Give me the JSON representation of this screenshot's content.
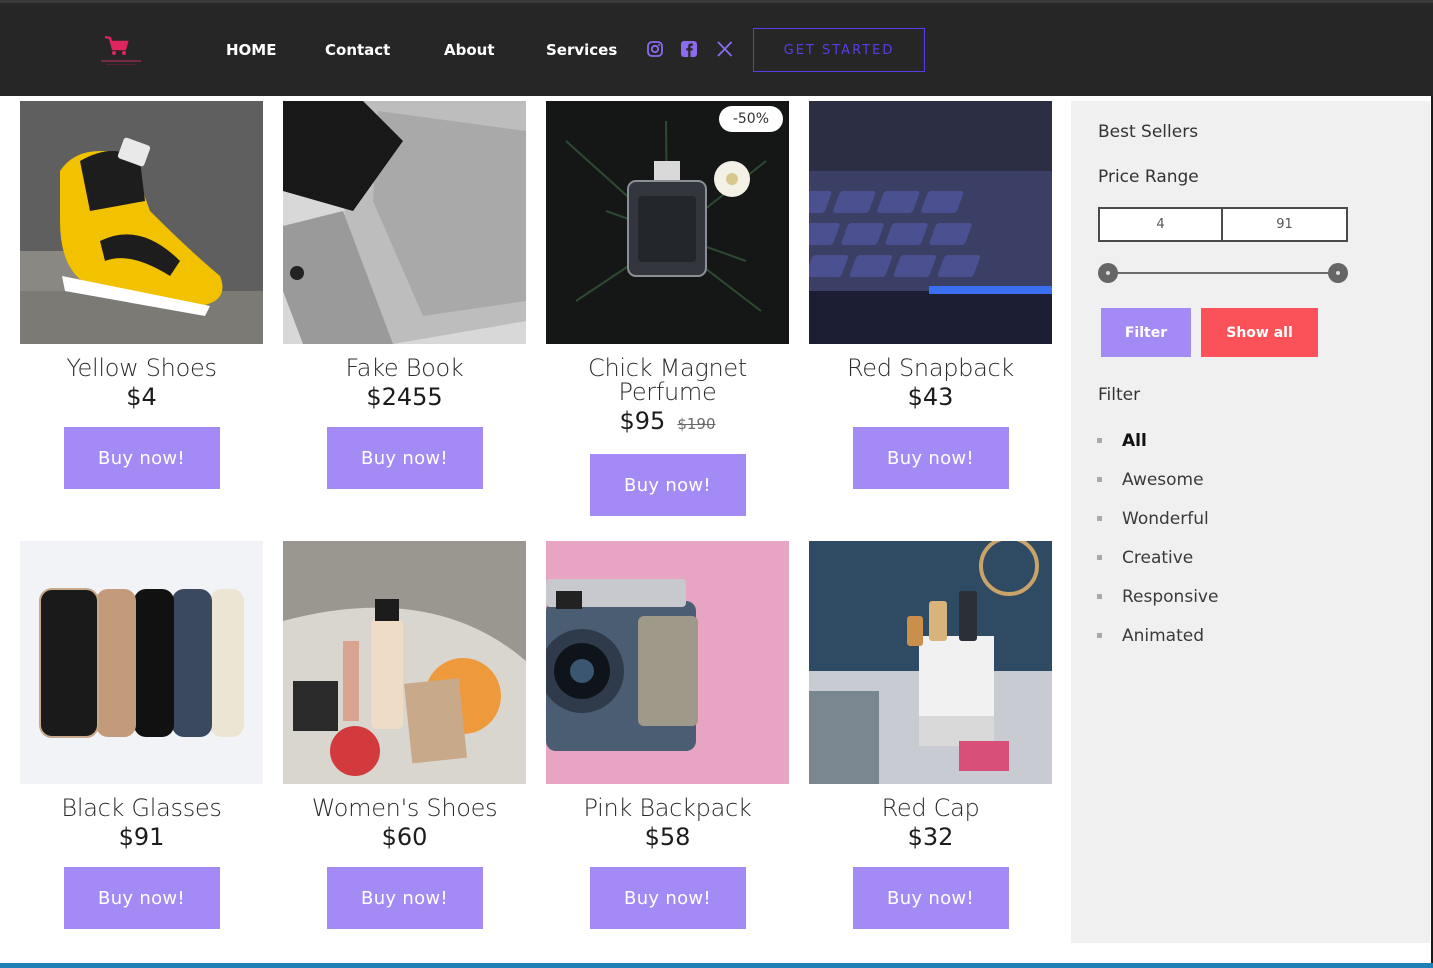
{
  "nav": {
    "links": [
      "HOME",
      "Contact",
      "About",
      "Services"
    ],
    "cta": "GET STARTED",
    "social_icons": [
      "instagram-icon",
      "facebook-icon",
      "x-twitter-icon"
    ],
    "accent": "#5b3be8",
    "logo_icon": "shopping-cart-icon",
    "logo_color": "#e0245e"
  },
  "products": [
    {
      "title": "Yellow Shoes",
      "price": "$4",
      "old_price": "",
      "badge": "",
      "button": "Buy now!"
    },
    {
      "title": "Fake Book",
      "price": "$2455",
      "old_price": "",
      "badge": "",
      "button": "Buy now!"
    },
    {
      "title": "Chick Magnet Perfume",
      "price": "$95",
      "old_price": "$190",
      "badge": "-50%",
      "button": "Buy now!"
    },
    {
      "title": "Red Snapback",
      "price": "$43",
      "old_price": "",
      "badge": "",
      "button": "Buy now!"
    },
    {
      "title": "Black Glasses",
      "price": "$91",
      "old_price": "",
      "badge": "",
      "button": "Buy now!"
    },
    {
      "title": "Women's Shoes",
      "price": "$60",
      "old_price": "",
      "badge": "",
      "button": "Buy now!"
    },
    {
      "title": "Pink Backpack",
      "price": "$58",
      "old_price": "",
      "badge": "",
      "button": "Buy now!"
    },
    {
      "title": "Red Cap",
      "price": "$32",
      "old_price": "",
      "badge": "",
      "button": "Buy now!"
    }
  ],
  "sidebar": {
    "best_sellers": "Best Sellers",
    "price_range": "Price Range",
    "min": "4",
    "max": "91",
    "filter_button": "Filter",
    "show_all_button": "Show all",
    "filter_heading": "Filter",
    "filters": [
      "All",
      "Awesome",
      "Wonderful",
      "Creative",
      "Responsive",
      "Animated"
    ],
    "active_filter": "All"
  },
  "colors": {
    "buy_button": "#a48af5",
    "show_all": "#fb5259",
    "navbar": "#262626"
  }
}
